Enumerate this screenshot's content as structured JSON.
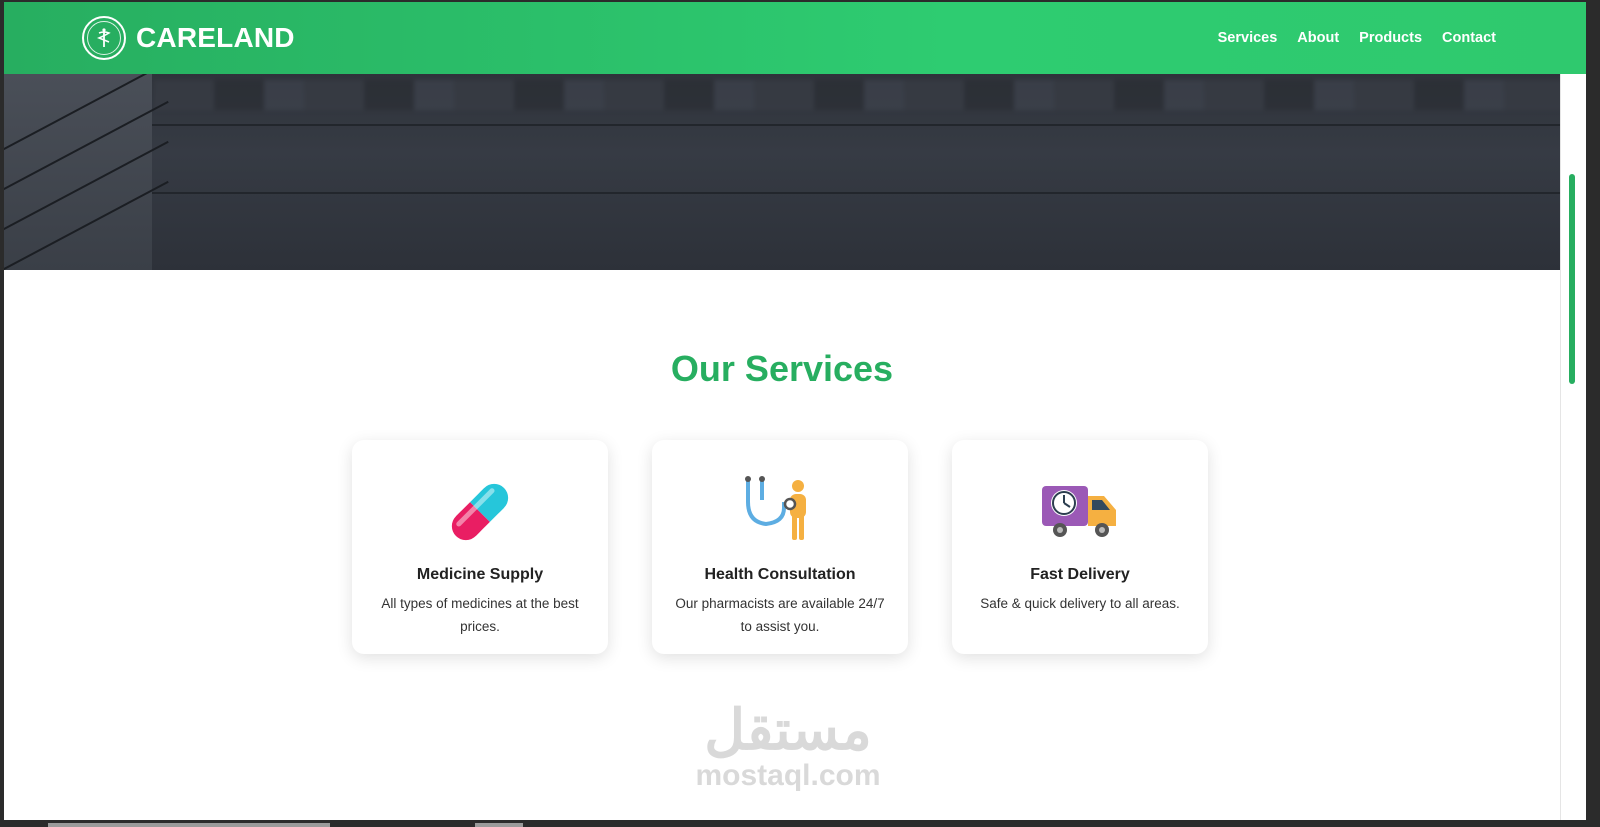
{
  "navbar": {
    "brand": "CARELAND",
    "links": [
      "Services",
      "About",
      "Products",
      "Contact"
    ]
  },
  "services": {
    "title": "Our Services",
    "cards": [
      {
        "icon": "pill-capsule-icon",
        "title": "Medicine Supply",
        "desc": "All types of medicines at the best prices."
      },
      {
        "icon": "stethoscope-doctor-icon",
        "title": "Health Consultation",
        "desc": "Our pharmacists are available 24/7 to assist you."
      },
      {
        "icon": "delivery-truck-icon",
        "title": "Fast Delivery",
        "desc": "Safe & quick delivery to all areas."
      }
    ]
  },
  "watermark": {
    "arabic": "مستقل",
    "latin": "mostaql.com"
  },
  "colors": {
    "accent": "#27ae60",
    "accent_light": "#2ecc71",
    "text_dark": "#222222"
  }
}
